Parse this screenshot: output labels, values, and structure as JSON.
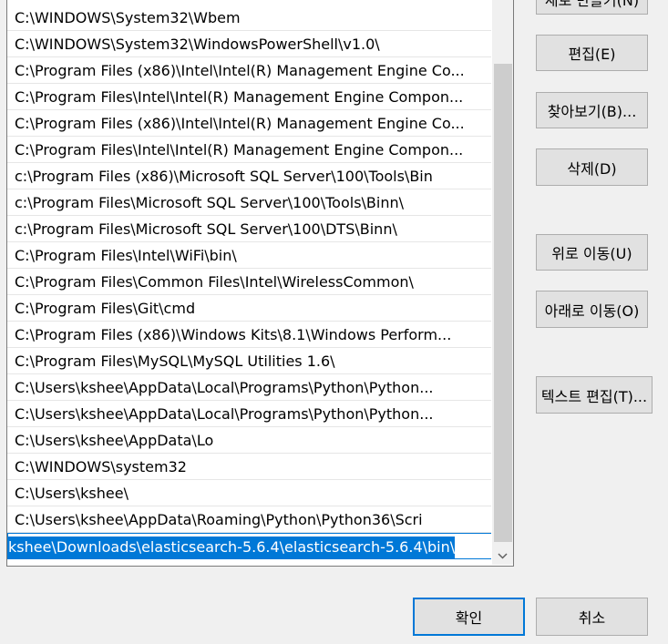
{
  "path_entries": [
    "C:\\WINDOWS\\System32\\Wbem",
    "C:\\WINDOWS\\System32\\WindowsPowerShell\\v1.0\\",
    "C:\\Program Files (x86)\\Intel\\Intel(R) Management Engine Co...",
    "C:\\Program Files\\Intel\\Intel(R) Management Engine Compon...",
    "C:\\Program Files (x86)\\Intel\\Intel(R) Management Engine Co...",
    "C:\\Program Files\\Intel\\Intel(R) Management Engine Compon...",
    "c:\\Program Files (x86)\\Microsoft SQL Server\\100\\Tools\\Bin",
    "c:\\Program Files\\Microsoft SQL Server\\100\\Tools\\Binn\\",
    "c:\\Program Files\\Microsoft SQL Server\\100\\DTS\\Binn\\",
    "C:\\Program Files\\Intel\\WiFi\\bin\\",
    "C:\\Program Files\\Common Files\\Intel\\WirelessCommon\\",
    "C:\\Program Files\\Git\\cmd",
    "C:\\Program Files (x86)\\Windows Kits\\8.1\\Windows Perform...",
    "C:\\Program Files\\MySQL\\MySQL Utilities 1.6\\",
    "C:\\Users\\kshee\\AppData\\Local\\Programs\\Python\\Python...",
    "C:\\Users\\kshee\\AppData\\Local\\Programs\\Python\\Python...",
    "C:\\Users\\kshee\\AppData\\Lo",
    "C:\\WINDOWS\\system32",
    "C:\\Users\\kshee\\",
    "C:\\Users\\kshee\\AppData\\Roaming\\Python\\Python36\\Scri"
  ],
  "editing_entry": "\\kshee\\Downloads\\elasticsearch-5.6.4\\elasticsearch-5.6.4\\bin",
  "buttons": {
    "new": "새로 만들기(N)",
    "edit": "편집(E)",
    "browse": "찾아보기(B)...",
    "delete": "삭제(D)",
    "move_up": "위로 이동(U)",
    "move_down": "아래로 이동(O)",
    "edit_text": "텍스트 편집(T)...",
    "ok": "확인",
    "cancel": "취소"
  },
  "colors": {
    "selection": "#0078d7",
    "background": "#f0f0f0"
  },
  "icons": {
    "scroll_down": "chevron-down-icon"
  }
}
